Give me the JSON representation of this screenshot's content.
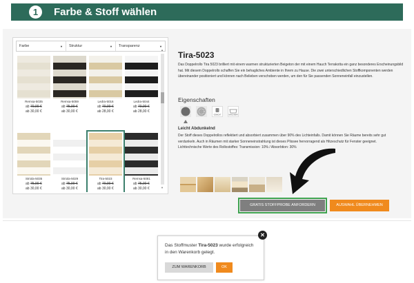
{
  "header": {
    "step_number": "1",
    "title": "Farbe & Stoff wählen"
  },
  "filters": {
    "farbe": "Farbe",
    "struktur": "Struktur",
    "transparenz": "Transparenz"
  },
  "tiles": [
    {
      "name": "Remsa-5035",
      "old_price": "70,00 €",
      "price": "30,00 €",
      "ab": "ab",
      "colors": [
        "#eeeae0",
        "#e5e0d1"
      ]
    },
    {
      "name": "Remsa-5059",
      "old_price": "75,00 €",
      "price": "30,00 €",
      "ab": "ab",
      "colors": [
        "#ddd9cd",
        "#2a2723"
      ]
    },
    {
      "name": "Ledra-5016",
      "old_price": "70,00 €",
      "price": "28,00 €",
      "ab": "ab",
      "colors": [
        "#f3f1ea",
        "#d9c9a2"
      ]
    },
    {
      "name": "Ledra-5044",
      "old_price": "70,00 €",
      "price": "28,00 €",
      "ab": "ab",
      "colors": [
        "#f5f5f5",
        "#1e1e1e"
      ]
    },
    {
      "name": "Striola-5035",
      "old_price": "75,00 €",
      "price": "30,00 €",
      "ab": "ab",
      "colors": [
        "#e2d6b9",
        "#fbf8f0"
      ]
    },
    {
      "name": "Striola-5029",
      "old_price": "75,00 €",
      "price": "30,00 €",
      "ab": "ab",
      "colors": [
        "#ffffff",
        "#f0f0f0"
      ]
    },
    {
      "name": "Tira-5023",
      "old_price": "70,00 €",
      "price": "30,00 €",
      "ab": "ab",
      "colors": [
        "#e6cfa6",
        "#f5ead6"
      ]
    },
    {
      "name": "Remsa-5081",
      "old_price": "75,00 €",
      "price": "30,00 €",
      "ab": "ab",
      "colors": [
        "#2b2b2b",
        "#ebebeb"
      ]
    }
  ],
  "product": {
    "title": "Tira-5023",
    "description": "Das Doppelrollo Tira 5023 brilliert mit einem warmen strukturierten Beigeton der mit einem Hauch Terrakotta ein ganz besonderes Erscheinungsbild hat. Mit diesem Doppelrollo schaffen Sie ein behagliches Ambiente in Ihrem zu Hause. Die zwei unterschiedlichen Stoffkomponenten werden übereinander positioniert und können nach Belieben verschoben werden, um den für Sie passenden Sonneneinfall einzustellen."
  },
  "eigenschaften": {
    "title": "Eigenschaften",
    "icons": [
      "dark-circle-icon",
      "mesh-circle-icon",
      "weight-icon",
      "wash-icon"
    ],
    "weight_label": "GEWICHT",
    "wash_label": "WASCHBAR"
  },
  "property": {
    "title": "Leicht Abdunkelnd",
    "description": "Der Stoff dieses Doppelrollos reflektiert und absorbiert zusammen über 90% des Lichteinfalls. Damit können Sie Räume bereits sehr gut verdunkeln. Auch in Räumen mit starker Sonneneinstrahlung ist dieses Plissee hervorragend als Hitzeschutz für Fenster geeignet.",
    "technical": "Lichttechnische Werte des Rollostoffes: Transmission: 10% / Absorbtion: 30%"
  },
  "buttons": {
    "sample": "GRATIS STOFFPROBE ANFORDERN",
    "accept": "AUSWAHL ÜBERNEHMEN"
  },
  "popup": {
    "text_before": "Das Stoffmuster ",
    "product": "Tira-5023",
    "text_after": " wurde erfolgreich in den Warenkorb gelegt.",
    "cart_button": "ZUM WARENKORB",
    "ok_button": "OK"
  },
  "colors": {
    "header_green": "#2d6b5a",
    "accent_orange": "#f08a1d",
    "highlight_green": "#3ea24f"
  }
}
